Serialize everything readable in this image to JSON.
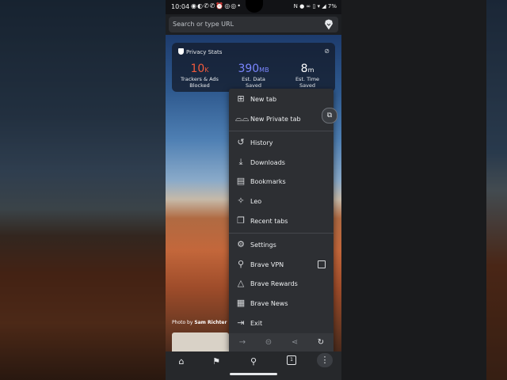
{
  "status_bar": {
    "time": "10:04",
    "battery": "7%",
    "left_icons": [
      "whatsapp-icon",
      "phone-icon",
      "messenger-icon",
      "messenger-icon",
      "alarm-icon",
      "check-circle-icon",
      "check-circle-icon",
      "dot-icon"
    ],
    "right_icons": [
      "nfc-icon",
      "record-icon",
      "link-icon",
      "vibrate-icon",
      "wifi-icon",
      "signal-icon",
      "battery-icon"
    ]
  },
  "url_bar": {
    "placeholder": "Search or type URL",
    "brave_icon": "brave-lion-icon"
  },
  "privacy_stats": {
    "title": "Privacy Stats",
    "stats": [
      {
        "value": "10",
        "unit": "K",
        "label_line1": "Trackers & Ads",
        "label_line2": "Blocked",
        "color": "#f05a3c"
      },
      {
        "value": "390",
        "unit": "MB",
        "label_line1": "Est. Data",
        "label_line2": "Saved",
        "color": "#7a86ff"
      },
      {
        "value": "8",
        "unit": "m",
        "label_line1": "Est. Time",
        "label_line2": "Saved",
        "color": "#ffffff"
      }
    ]
  },
  "menu": {
    "items": [
      {
        "label": "New tab",
        "icon": "new-tab-icon"
      },
      {
        "label": "New Private tab",
        "icon": "private-glasses-icon"
      },
      {
        "label": "History",
        "icon": "history-icon"
      },
      {
        "label": "Downloads",
        "icon": "download-icon"
      },
      {
        "label": "Bookmarks",
        "icon": "bookmark-icon"
      },
      {
        "label": "Leo",
        "icon": "leo-sparkle-icon"
      },
      {
        "label": "Recent tabs",
        "icon": "recent-tabs-icon"
      },
      {
        "label": "Settings",
        "icon": "gear-icon"
      },
      {
        "label": "Brave VPN",
        "icon": "vpn-icon"
      },
      {
        "label": "Brave Rewards",
        "icon": "rewards-triangle-icon"
      },
      {
        "label": "Brave News",
        "icon": "news-icon"
      },
      {
        "label": "Exit",
        "icon": "exit-icon"
      }
    ],
    "vpn_enabled": false,
    "actions": [
      "forward-icon",
      "download-icon",
      "share-icon",
      "reload-icon"
    ]
  },
  "photo_credit": {
    "prefix": "Photo by",
    "author": "Sam Richter"
  },
  "bottom_bar": {
    "tab_count": "1",
    "icons": [
      "home-icon",
      "bookmark-icon",
      "search-icon",
      "tabs-icon",
      "more-icon"
    ]
  },
  "colors": {
    "menu_bg": "#2d2f33",
    "accent_red": "#f05a3c",
    "accent_blue": "#7a86ff"
  }
}
